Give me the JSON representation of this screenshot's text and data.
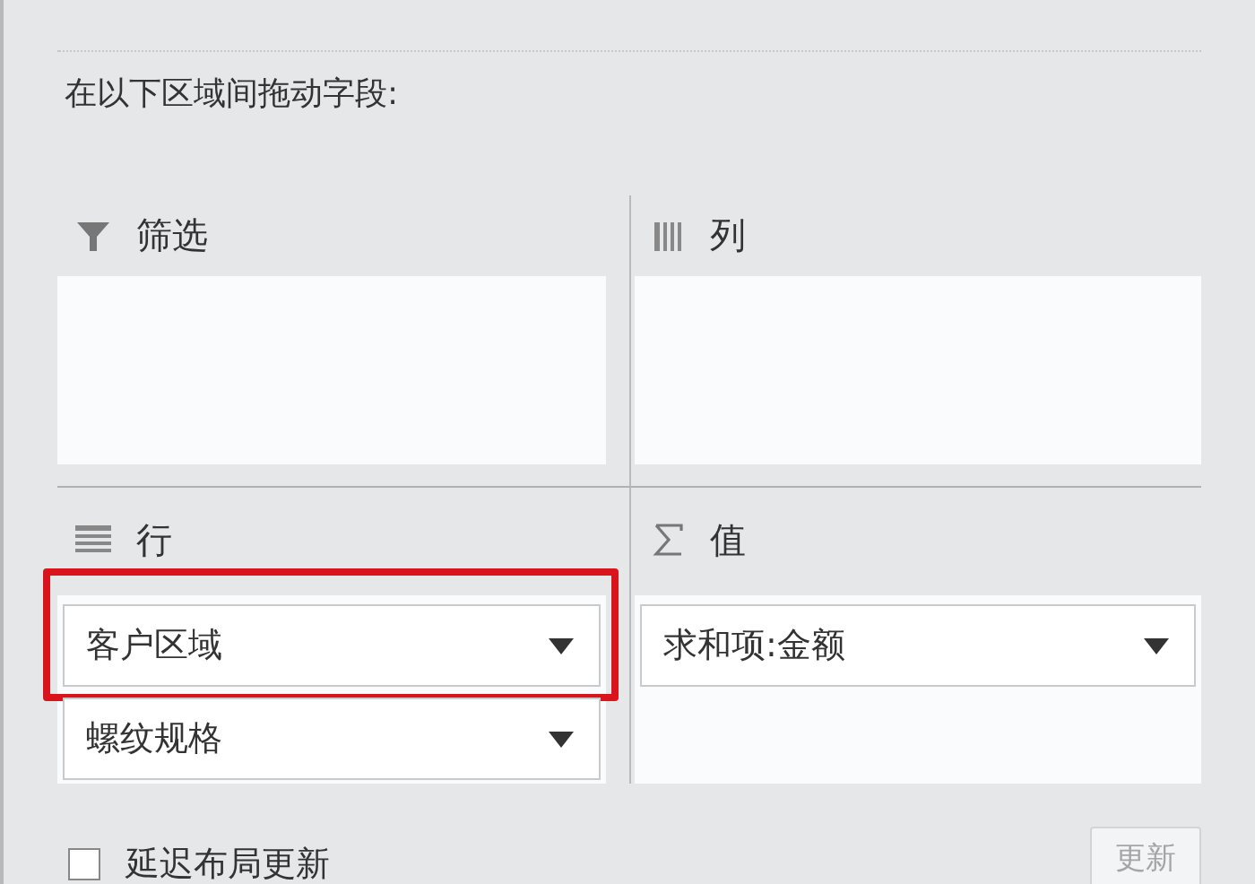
{
  "instruction": "在以下区域间拖动字段:",
  "areas": [
    {
      "kind": "filter",
      "title": "筛选"
    },
    {
      "kind": "columns",
      "title": "列"
    },
    {
      "kind": "rows",
      "title": "行",
      "fields": [
        {
          "label": "客户区域",
          "highlighted": true
        },
        {
          "label": "螺纹规格",
          "highlighted": false
        }
      ]
    },
    {
      "kind": "values",
      "title": "值",
      "fields": [
        {
          "label": "求和项:金额",
          "highlighted": false
        }
      ]
    }
  ],
  "defer_update": {
    "label": "延迟布局更新",
    "checked": false
  },
  "update_button": {
    "label": "更新",
    "disabled": true
  }
}
